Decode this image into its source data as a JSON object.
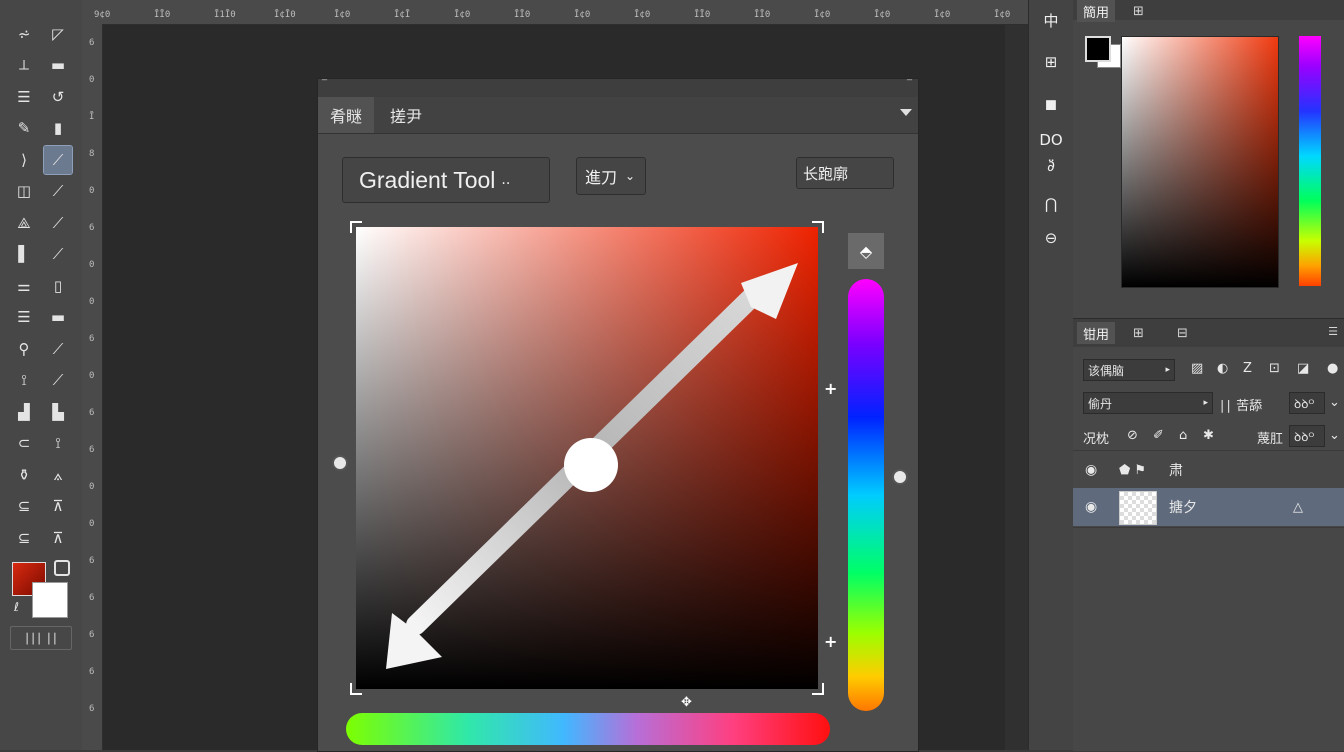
{
  "toolbar": {
    "tools": [
      "⩫",
      "◸",
      "⟂",
      "▬",
      "☰",
      "↺",
      "✎",
      "▮",
      "⟩",
      "⟋",
      "◫",
      "⟋",
      "⟁",
      "⟋",
      "▌",
      "⟋",
      "⚌",
      "▯",
      "☰",
      "▬",
      "⚲",
      "⟋",
      "⟟",
      "⟋",
      "▟",
      "▙",
      "⊂",
      "⟟",
      "⚱",
      "⟑",
      "⊆",
      "⊼",
      "⊆",
      "⊼"
    ],
    "color_labels": [
      "ℓ"
    ],
    "mode_button": "∣∣∣ ∣∣"
  },
  "ruler": {
    "top_ticks": [
      "9¢0",
      "ĪĪ0",
      "Ī1Ī0",
      "Ī¢Ī0",
      "Ī¢0",
      "Ī¢Ī",
      "Ī¢0",
      "ĪĪ0",
      "Ī¢0",
      "Ī¢0",
      "ĪĪ0",
      "ĪĪ0",
      "Ī¢0",
      "Ī¢0",
      "Ī¢0",
      "Ī¢0"
    ],
    "left_ticks": [
      "6",
      "0",
      "Ī",
      "8",
      "0",
      "6",
      "0",
      "0",
      "6",
      "0",
      "6",
      "6",
      "0",
      "0",
      "6",
      "6",
      "6",
      "6",
      "6"
    ]
  },
  "dialog": {
    "tabs": [
      "肴瞇",
      "搓尹"
    ],
    "tool_label": "Gradient Tool",
    "tool_caret": "..",
    "mode_label": "進刀",
    "mode_caret": "⌄",
    "right_label": "长跑廓"
  },
  "icon_column": {
    "items": [
      "中",
      "⊞",
      "◼",
      "DO",
      "∂̈",
      "⋂",
      "⊖"
    ]
  },
  "right_panel": {
    "color_tabs": [
      "簡用",
      "⊞"
    ],
    "layer_tabs": [
      "钳用",
      "⊞",
      "⊟"
    ],
    "kind_label": "该偶脑",
    "blend_mode": "偷丹",
    "opacity_label": "∣∣ 苦舔",
    "opacity_value": "ꝺꝺᴼ",
    "lock_label": "况枕",
    "fill_label": "蔑肛",
    "fill_value": "ꝺꝺᴼ",
    "layers": [
      {
        "name": "肃",
        "selected": false
      },
      {
        "name": "搪夕",
        "selected": true
      }
    ]
  }
}
